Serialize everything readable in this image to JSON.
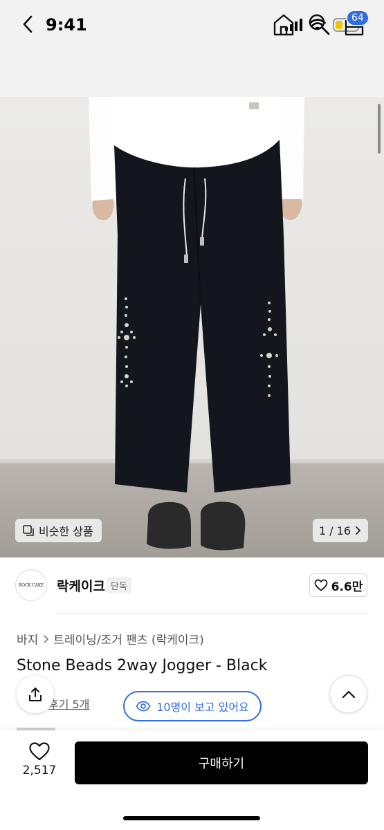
{
  "status": {
    "time": "9:41",
    "battery_color": "#f5c400"
  },
  "nav": {
    "back_icon": "chevron-left-icon",
    "home_icon": "home-icon",
    "search_icon": "search-icon",
    "cart_icon": "cart-icon",
    "cart_count": "64",
    "badge_color": "#2f6ce5"
  },
  "gallery": {
    "similar_label": "비슷한 상품",
    "counter": "1 / 16"
  },
  "brand": {
    "logo_text": "ROCK CAKE",
    "name": "락케이크",
    "tag": "단독",
    "likes": "6.6만"
  },
  "breadcrumb": {
    "category": "바지",
    "subcategory": "트레이닝/조거 팬츠 (락케이크)"
  },
  "product": {
    "title": "Stone Beads 2way Jogger - Black",
    "review_text": "후기 5개",
    "viewers": "10명이 보고 있어요"
  },
  "bottom": {
    "wish_count": "2,517",
    "buy_label": "구매하기"
  }
}
